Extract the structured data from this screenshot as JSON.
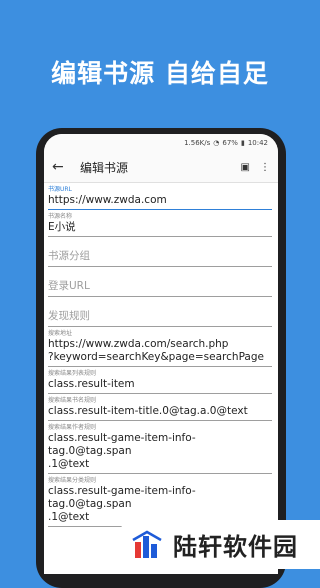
{
  "promo": {
    "title": "编辑书源  自给自足"
  },
  "status": {
    "speed": "1.56K/s",
    "battery": "67%",
    "time": "10:42"
  },
  "appbar": {
    "title": "编辑书源"
  },
  "fields": [
    {
      "label": "书源URL",
      "value": "https://www.zwda.com"
    },
    {
      "label": "书源名称",
      "value": "E小说"
    },
    {
      "placeholder": "书源分组"
    },
    {
      "placeholder": "登录URL"
    },
    {
      "placeholder": "发现规则"
    },
    {
      "label": "搜索地址",
      "value": "https://www.zwda.com/search.php\n?keyword=searchKey&page=searchPage"
    },
    {
      "label": "搜索结果列表规则",
      "value": "class.result-item"
    },
    {
      "label": "搜索结果书名规则",
      "value": "class.result-item-title.0@tag.a.0@text"
    },
    {
      "label": "搜索结果作者规则",
      "value": "class.result-game-item-info-tag.0@tag.span\n.1@text"
    },
    {
      "label": "搜索结果分类规则",
      "value": "class.result-game-item-info-tag.0@tag.span\n.1@text"
    }
  ],
  "watermark": {
    "text": "陆轩软件园"
  }
}
